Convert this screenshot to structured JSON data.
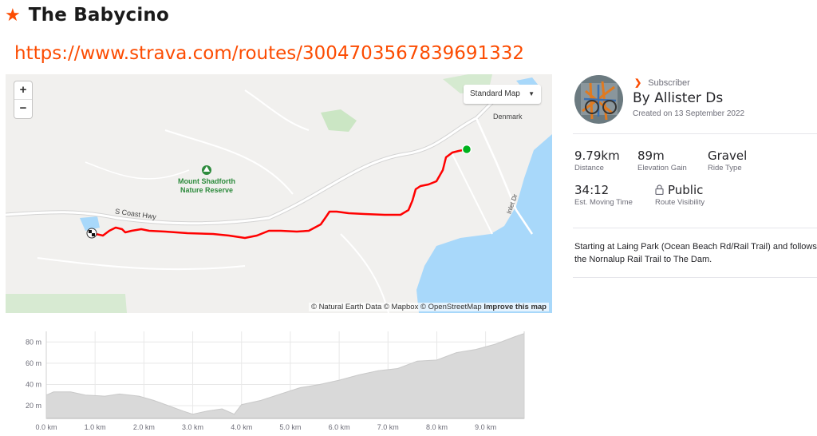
{
  "page": {
    "star_icon": "star-icon",
    "title": "The Babycino",
    "url": "https://www.strava.com/routes/3004703567839691332"
  },
  "map": {
    "zoom_in": "+",
    "zoom_out": "−",
    "style_label": "Standard Map",
    "labels": {
      "park": "Mount Shadforth Nature Reserve",
      "park_line1": "Mount Shadforth",
      "park_line2": "Nature Reserve",
      "highway": "S Coast Hwy",
      "town": "Denmark",
      "road": "Inlet Dr"
    },
    "attribution_prefix": "© Natural Earth Data © Mapbox © OpenStreetMap ",
    "attribution_link": "Improve this map",
    "route_color": "#ff0000",
    "start_color": "#00b21e",
    "water_color": "#a8d8fa"
  },
  "profile": {
    "badge": "Subscriber",
    "author": "By Allister Ds",
    "created": "Created on 13 September 2022"
  },
  "stats": [
    {
      "value": "9.79km",
      "label": "Distance"
    },
    {
      "value": "89m",
      "label": "Elevation Gain"
    },
    {
      "value": "Gravel",
      "label": "Ride Type"
    },
    {
      "value": "34:12",
      "label": "Est. Moving Time"
    },
    {
      "value": "Public",
      "label": "Route Visibility",
      "icon": "lock-icon"
    }
  ],
  "description": "Starting at Laing Park (Ocean Beach Rd/Rail Trail) and follows the Nornalup Rail Trail to The Dam.",
  "chart_data": {
    "type": "area",
    "xlabel": "",
    "ylabel": "",
    "x_ticks": [
      "0.0 km",
      "1.0 km",
      "2.0 km",
      "3.0 km",
      "4.0 km",
      "5.0 km",
      "6.0 km",
      "7.0 km",
      "8.0 km",
      "9.0 km"
    ],
    "y_ticks": [
      "20 m",
      "40 m",
      "60 m",
      "80 m"
    ],
    "xlim": [
      0,
      9.79
    ],
    "ylim": [
      8,
      90
    ],
    "grid": true,
    "x": [
      0,
      0.15,
      0.5,
      0.8,
      1.2,
      1.5,
      1.9,
      2.2,
      2.5,
      2.8,
      3.0,
      3.3,
      3.6,
      3.85,
      4.0,
      4.4,
      4.8,
      5.2,
      5.6,
      6.0,
      6.4,
      6.8,
      7.2,
      7.6,
      8.0,
      8.4,
      8.8,
      9.2,
      9.6,
      9.79
    ],
    "y": [
      30,
      33,
      33,
      30,
      29,
      31,
      29,
      25,
      20,
      15,
      12,
      15,
      17,
      12,
      21,
      25,
      31,
      37,
      40,
      44,
      49,
      53,
      55,
      62,
      63,
      70,
      73,
      78,
      85,
      88
    ],
    "fill_color": "#d9d9d9"
  }
}
